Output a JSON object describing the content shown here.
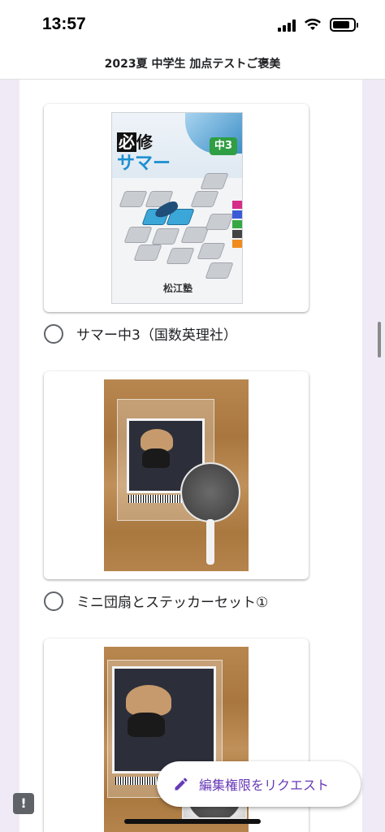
{
  "status_bar": {
    "time": "13:57"
  },
  "header": {
    "title": "2023夏 中学生 加点テストご褒美"
  },
  "options": [
    {
      "label": "サマー中3（国数英理社）",
      "image": {
        "brand_text_1": "必",
        "brand_text_2": "修",
        "series": "サマー",
        "grade": "中3",
        "publisher": "松江塾"
      }
    },
    {
      "label": "ミニ団扇とステッカーセット①"
    },
    {
      "label": ""
    }
  ],
  "fab": {
    "label": "編集権限をリクエスト",
    "icon": "pencil-icon"
  },
  "feedback": {
    "icon": "feedback-icon"
  },
  "colors": {
    "accent": "#673ab7",
    "background": "#efeaf6",
    "radio_border": "#5f6368"
  }
}
